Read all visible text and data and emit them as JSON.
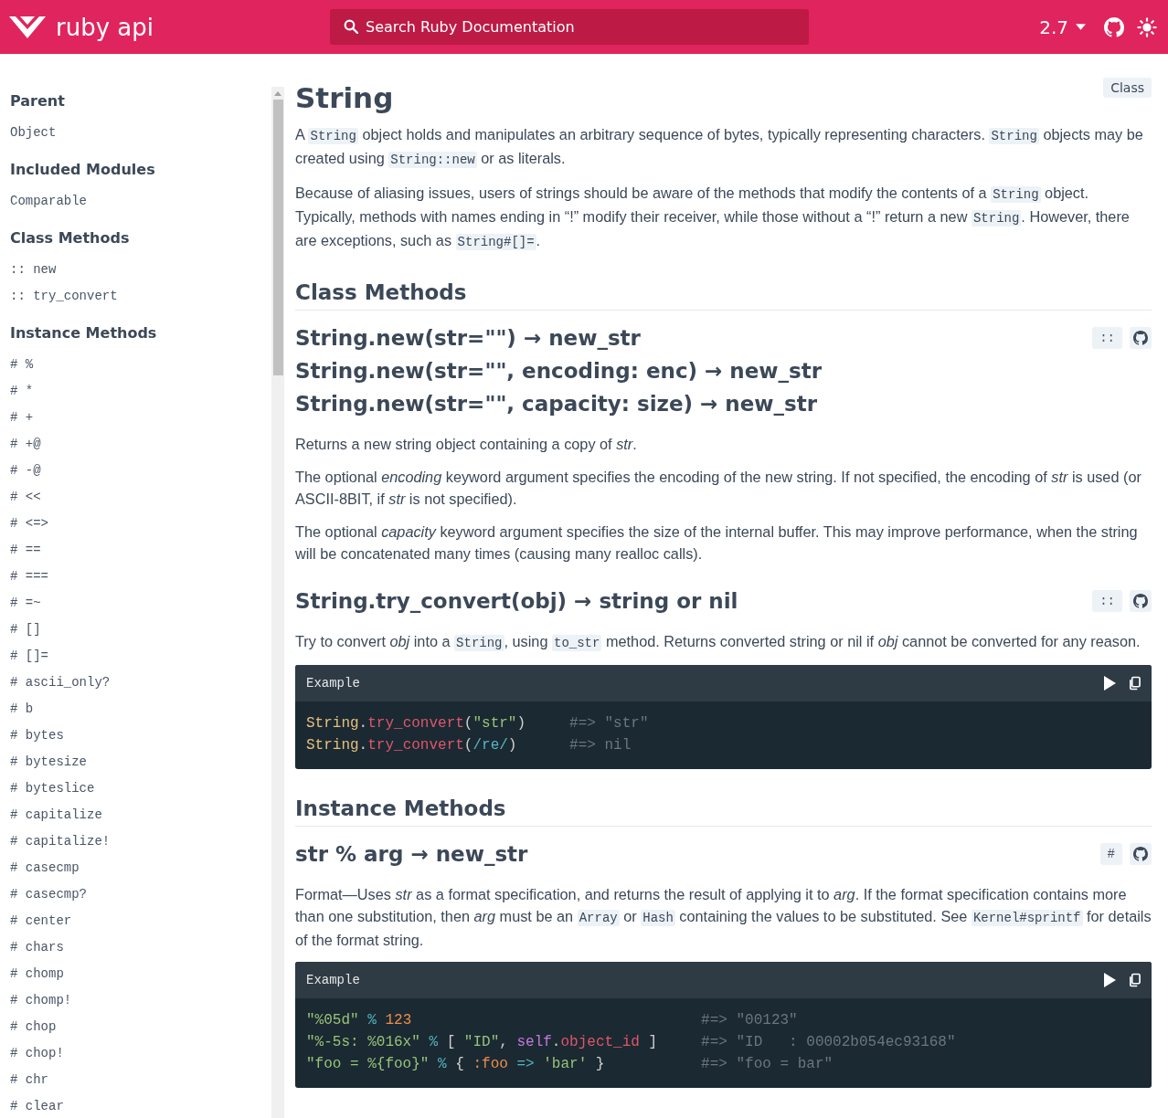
{
  "header": {
    "logo": "ruby api",
    "search": {
      "placeholder": "Search Ruby Documentation"
    },
    "version": "2.7"
  },
  "sidebar": {
    "sections": [
      {
        "heading": "Parent",
        "items": [
          "Object"
        ]
      },
      {
        "heading": "Included Modules",
        "items": [
          "Comparable"
        ]
      },
      {
        "heading": "Class Methods",
        "items": [
          ":: new",
          ":: try_convert"
        ]
      },
      {
        "heading": "Instance Methods",
        "items": [
          "# %",
          "# *",
          "# +",
          "# +@",
          "# -@",
          "# <<",
          "# <=>",
          "# ==",
          "# ===",
          "# =~",
          "# []",
          "# []=",
          "# ascii_only?",
          "# b",
          "# bytes",
          "# bytesize",
          "# byteslice",
          "# capitalize",
          "# capitalize!",
          "# casecmp",
          "# casecmp?",
          "# center",
          "# chars",
          "# chomp",
          "# chomp!",
          "# chop",
          "# chop!",
          "# chr",
          "# clear"
        ]
      }
    ]
  },
  "page": {
    "title": "String",
    "badge": "Class",
    "intro": [
      [
        {
          "kind": "text",
          "text": "A "
        },
        {
          "kind": "code",
          "text": "String"
        },
        {
          "kind": "text",
          "text": " object holds and manipulates an arbitrary sequence of bytes, typically representing characters. "
        },
        {
          "kind": "code",
          "text": "String"
        },
        {
          "kind": "text",
          "text": " objects may be created using "
        },
        {
          "kind": "code",
          "text": "String::new"
        },
        {
          "kind": "text",
          "text": " or as literals."
        }
      ],
      [
        {
          "kind": "text",
          "text": "Because of aliasing issues, users of strings should be aware of the methods that modify the contents of a "
        },
        {
          "kind": "code",
          "text": "String"
        },
        {
          "kind": "text",
          "text": " object. Typically, methods with names ending in “!” modify their receiver, while those without a “!” return a new "
        },
        {
          "kind": "code",
          "text": "String"
        },
        {
          "kind": "text",
          "text": ". However, there are exceptions, such as "
        },
        {
          "kind": "code",
          "text": "String#[]="
        },
        {
          "kind": "text",
          "text": "."
        }
      ]
    ],
    "sections": [
      {
        "heading": "Class Methods",
        "methods": [
          {
            "signatures": [
              "String.new(str=\"\") → new_str",
              "String.new(str=\"\", encoding: enc) → new_str",
              "String.new(str=\"\", capacity: size) → new_str"
            ],
            "badge": "::",
            "paragraphs": [
              [
                {
                  "kind": "text",
                  "text": "Returns a new string object containing a copy of "
                },
                {
                  "kind": "em",
                  "text": "str"
                },
                {
                  "kind": "text",
                  "text": "."
                }
              ],
              [
                {
                  "kind": "text",
                  "text": "The optional "
                },
                {
                  "kind": "em",
                  "text": "encoding"
                },
                {
                  "kind": "text",
                  "text": " keyword argument specifies the encoding of the new string. If not specified, the encoding of "
                },
                {
                  "kind": "em",
                  "text": "str"
                },
                {
                  "kind": "text",
                  "text": " is used (or ASCII-8BIT, if "
                },
                {
                  "kind": "em",
                  "text": "str"
                },
                {
                  "kind": "text",
                  "text": " is not specified)."
                }
              ],
              [
                {
                  "kind": "text",
                  "text": "The optional "
                },
                {
                  "kind": "em",
                  "text": "capacity"
                },
                {
                  "kind": "text",
                  "text": " keyword argument specifies the size of the internal buffer. This may improve performance, when the string will be concatenated many times (causing many realloc calls)."
                }
              ]
            ]
          },
          {
            "signatures": [
              "String.try_convert(obj) → string or nil"
            ],
            "badge": "::",
            "paragraphs": [
              [
                {
                  "kind": "text",
                  "text": "Try to convert "
                },
                {
                  "kind": "em",
                  "text": "obj"
                },
                {
                  "kind": "text",
                  "text": " into a "
                },
                {
                  "kind": "code",
                  "text": "String"
                },
                {
                  "kind": "text",
                  "text": ", using "
                },
                {
                  "kind": "code",
                  "text": "to_str"
                },
                {
                  "kind": "text",
                  "text": " method. Returns converted string or nil if "
                },
                {
                  "kind": "em",
                  "text": "obj"
                },
                {
                  "kind": "text",
                  "text": " cannot be converted for any reason."
                }
              ]
            ],
            "example": {
              "label": "Example",
              "lines": [
                {
                  "tokens": [
                    {
                      "kind": "const",
                      "text": "String"
                    },
                    {
                      "kind": "punct",
                      "text": "."
                    },
                    {
                      "kind": "method",
                      "text": "try_convert"
                    },
                    {
                      "kind": "punct",
                      "text": "("
                    },
                    {
                      "kind": "string",
                      "text": "\"str\""
                    },
                    {
                      "kind": "punct",
                      "text": ")"
                    }
                  ],
                  "comment": "#=> \"str\""
                },
                {
                  "tokens": [
                    {
                      "kind": "const",
                      "text": "String"
                    },
                    {
                      "kind": "punct",
                      "text": "."
                    },
                    {
                      "kind": "method",
                      "text": "try_convert"
                    },
                    {
                      "kind": "punct",
                      "text": "("
                    },
                    {
                      "kind": "regex",
                      "text": "/re/"
                    },
                    {
                      "kind": "punct",
                      "text": ")"
                    }
                  ],
                  "comment": "#=> nil"
                }
              ]
            }
          }
        ]
      },
      {
        "heading": "Instance Methods",
        "methods": [
          {
            "signatures": [
              "str % arg → new_str"
            ],
            "badge": "#",
            "paragraphs": [
              [
                {
                  "kind": "text",
                  "text": "Format—Uses "
                },
                {
                  "kind": "em",
                  "text": "str"
                },
                {
                  "kind": "text",
                  "text": " as a format specification, and returns the result of applying it to "
                },
                {
                  "kind": "em",
                  "text": "arg"
                },
                {
                  "kind": "text",
                  "text": ". If the format specification contains more than one substitution, then "
                },
                {
                  "kind": "em",
                  "text": "arg"
                },
                {
                  "kind": "text",
                  "text": " must be an "
                },
                {
                  "kind": "code",
                  "text": "Array"
                },
                {
                  "kind": "text",
                  "text": " or "
                },
                {
                  "kind": "code",
                  "text": "Hash"
                },
                {
                  "kind": "text",
                  "text": " containing the values to be substituted. See "
                },
                {
                  "kind": "code",
                  "text": "Kernel#sprintf"
                },
                {
                  "kind": "text",
                  "text": " for details of the format string."
                }
              ]
            ],
            "example": {
              "label": "Example",
              "lines": [
                {
                  "tokens": [
                    {
                      "kind": "string",
                      "text": "\"%05d\""
                    },
                    {
                      "kind": "operator",
                      "text": " % "
                    },
                    {
                      "kind": "number",
                      "text": "123"
                    }
                  ],
                  "comment": "#=> \"00123\""
                },
                {
                  "tokens": [
                    {
                      "kind": "string",
                      "text": "\"%-5s: %016x\""
                    },
                    {
                      "kind": "operator",
                      "text": " % "
                    },
                    {
                      "kind": "punct",
                      "text": "[ "
                    },
                    {
                      "kind": "string",
                      "text": "\"ID\""
                    },
                    {
                      "kind": "punct",
                      "text": ", "
                    },
                    {
                      "kind": "keyword",
                      "text": "self"
                    },
                    {
                      "kind": "punct",
                      "text": "."
                    },
                    {
                      "kind": "method",
                      "text": "object_id"
                    },
                    {
                      "kind": "punct",
                      "text": " ]"
                    }
                  ],
                  "comment": "#=> \"ID   : 00002b054ec93168\""
                },
                {
                  "tokens": [
                    {
                      "kind": "string",
                      "text": "\"foo = %{foo}\""
                    },
                    {
                      "kind": "operator",
                      "text": " % "
                    },
                    {
                      "kind": "punct",
                      "text": "{ "
                    },
                    {
                      "kind": "symbol",
                      "text": ":foo"
                    },
                    {
                      "kind": "operator",
                      "text": " => "
                    },
                    {
                      "kind": "string",
                      "text": "'bar'"
                    },
                    {
                      "kind": "punct",
                      "text": " }"
                    }
                  ],
                  "comment": "#=> \"foo = bar\""
                }
              ]
            }
          }
        ]
      }
    ]
  }
}
